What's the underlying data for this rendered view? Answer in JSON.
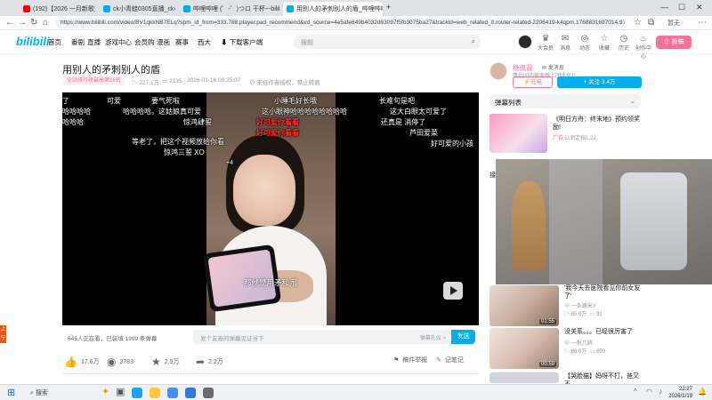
{
  "browser": {
    "tabs": [
      {
        "label": "(192)【2026 一月新歌】2026",
        "active": false
      },
      {
        "label": "ck小青蛙0305直播_ck小青蛙0305",
        "active": false
      },
      {
        "label": "哔哩哔哩 (゜-゜)つロ 干杯~-bilibili",
        "active": false
      },
      {
        "label": "用别人的矛刺别人的盾_哔哩哔哩_bilibili",
        "active": true
      }
    ],
    "url": "https://www.bilibili.com/video/BV1qkkNB7ELq?spm_id_from=333.788.player.pad_recommend&vd_source=4e5afe849b4032d63097f5fb3075ba27&trackid=web_related_0.router-related-2206419-k4qpm.1768831697014.972",
    "profile_label": "暂无"
  },
  "header": {
    "logo": "bilibili",
    "nav": [
      "首页",
      "番剧",
      "直播",
      "游戏中心",
      "会员购",
      "漫画",
      "赛事",
      "西大",
      "下载客户端"
    ],
    "search_placeholder": "搜题",
    "icons": [
      {
        "label": "大会员",
        "icon": "vip-icon"
      },
      {
        "label": "消息",
        "icon": "message-icon"
      },
      {
        "label": "动态",
        "icon": "dynamic-icon"
      },
      {
        "label": "收藏",
        "icon": "favorite-icon"
      },
      {
        "label": "历史",
        "icon": "history-icon"
      },
      {
        "label": "创作中心",
        "icon": "creator-icon"
      }
    ],
    "upload_label": "投稿"
  },
  "video": {
    "title": "用别人的矛刺别人的盾",
    "rank_badge": "全站排行榜最高第16名",
    "plays": "227.1万",
    "danmaku_count": "2135",
    "date": "2026-01-16 09:25:07",
    "copyright": "未经作者授权，禁止转载",
    "danmaku_lines": [
      {
        "text": "了",
        "color": "white"
      },
      {
        "text": "可爱",
        "color": "white"
      },
      {
        "text": "要气死啦",
        "color": "white"
      },
      {
        "text": "小睡毛好长哦",
        "color": "white"
      },
      {
        "text": "长难句是吧",
        "color": "white"
      },
      {
        "text": "哈哈哈哈",
        "color": "white"
      },
      {
        "text": "哈哈哈哈。这姑娘真可爱",
        "color": "white"
      },
      {
        "text": "这小眼神哈哈哈哈哈哈哈哈",
        "color": "white"
      },
      {
        "text": "这大白眼太可爱了",
        "color": "white"
      },
      {
        "text": "好可爱你看看",
        "color": "red"
      },
      {
        "text": "好可爱你看看",
        "color": "red"
      },
      {
        "text": "哈哈哈",
        "color": "white"
      },
      {
        "text": "惊鸿肆誓",
        "color": "white"
      },
      {
        "text": "还真是 消停了",
        "color": "white"
      },
      {
        "text": "等老了，把这个视频放给你看",
        "color": "white"
      },
      {
        "text": "芦田爱菜",
        "color": "white"
      },
      {
        "text": "好可爱的小孩",
        "color": "white"
      },
      {
        "text": "惊鸿三誓 XO",
        "color": "white"
      },
      {
        "text": "+4",
        "color": "white"
      }
    ],
    "subtitle": "那就是用矛和闹",
    "viewers": "645人正在看，已装填 1999 条弹幕",
    "danmaku_placeholder": "发个友善的弹幕见证当下",
    "danmaku_etiquette": "弹幕礼仪 >",
    "send_label": "发送"
  },
  "actions": {
    "like": "17.6万",
    "coin": "3783",
    "favorite": "2.9万",
    "share": "2.2万",
    "report": "稿件举报",
    "notes": "记笔记"
  },
  "uploader": {
    "name": "杨佩霞",
    "message_label": "发消息",
    "signature": "情侣间的宿舍跟上团比女儿",
    "charge_label": "充电",
    "follow_label": "+ 关注 3.4万"
  },
  "right": {
    "danmaku_list_label": "弹幕列表",
    "ad": {
      "title": "《明日方舟：终末地》预约领奖励!",
      "tag": "广告",
      "meta": "公测定档1.22"
    },
    "next_label": "接",
    "recs": [
      {
        "title": "'我今天去医院看见你前女友了'",
        "meta1": "一条路米Y",
        "views": "65.0万",
        "comments": "91",
        "duration": "01:55"
      },
      {
        "title": "没关系。。。已经很厉害了",
        "meta1": "一帆几鸥",
        "views": "86.0万",
        "comments": "699",
        "duration": "00:59"
      },
      {
        "title": "【哭脸猫】妈呀不打，爸又不",
        "meta1": "",
        "views": "",
        "comments": "",
        "duration": ""
      }
    ]
  },
  "taskbar": {
    "search_label": "搜索",
    "time": "22:27",
    "date": "2026/1/19",
    "side_mark": "上午"
  }
}
